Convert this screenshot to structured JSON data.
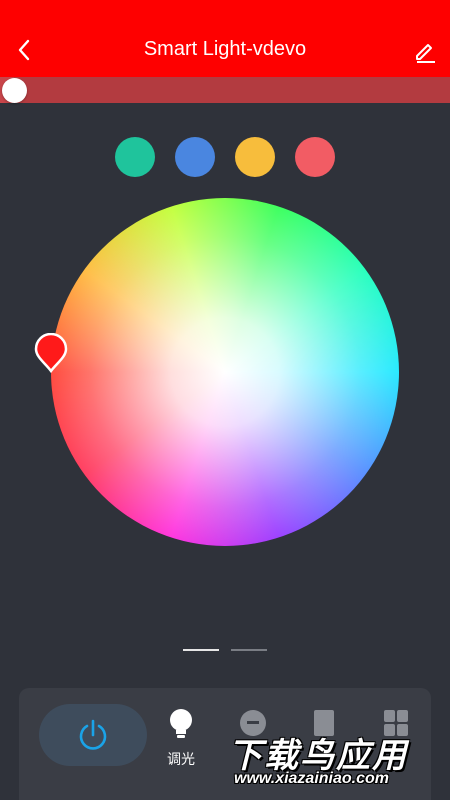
{
  "header": {
    "title": "Smart Light-vdevo",
    "back_icon": "chevron-left-icon",
    "edit_icon": "pencil-icon",
    "background": "#fe0000"
  },
  "brightness": {
    "level": 0.03,
    "track_color": "#b33b40"
  },
  "presets": [
    {
      "name": "preset-teal",
      "color": "#1fc49c"
    },
    {
      "name": "preset-blue",
      "color": "#4a86e0"
    },
    {
      "name": "preset-yellow",
      "color": "#f7bd3c"
    },
    {
      "name": "preset-coral",
      "color": "#f25c64"
    }
  ],
  "color_picker": {
    "selected_color": "#ff1a1a"
  },
  "pager": {
    "pages": 2,
    "active": 0,
    "active_color": "#e6e6e6",
    "inactive_color": "#7a7d84"
  },
  "dock": {
    "power_icon": "power-icon",
    "power_color": "#1aa3e8",
    "modes": [
      {
        "icon": "bulb-icon",
        "label": "调光",
        "active": true
      },
      {
        "icon": "scene-icon",
        "label": "",
        "active": false
      },
      {
        "icon": "music-icon",
        "label": "",
        "active": false
      },
      {
        "icon": "grid-icon",
        "label": "",
        "active": false
      }
    ]
  },
  "watermark": {
    "title": "下载鸟应用",
    "url": "www.xiazainiao.com"
  }
}
